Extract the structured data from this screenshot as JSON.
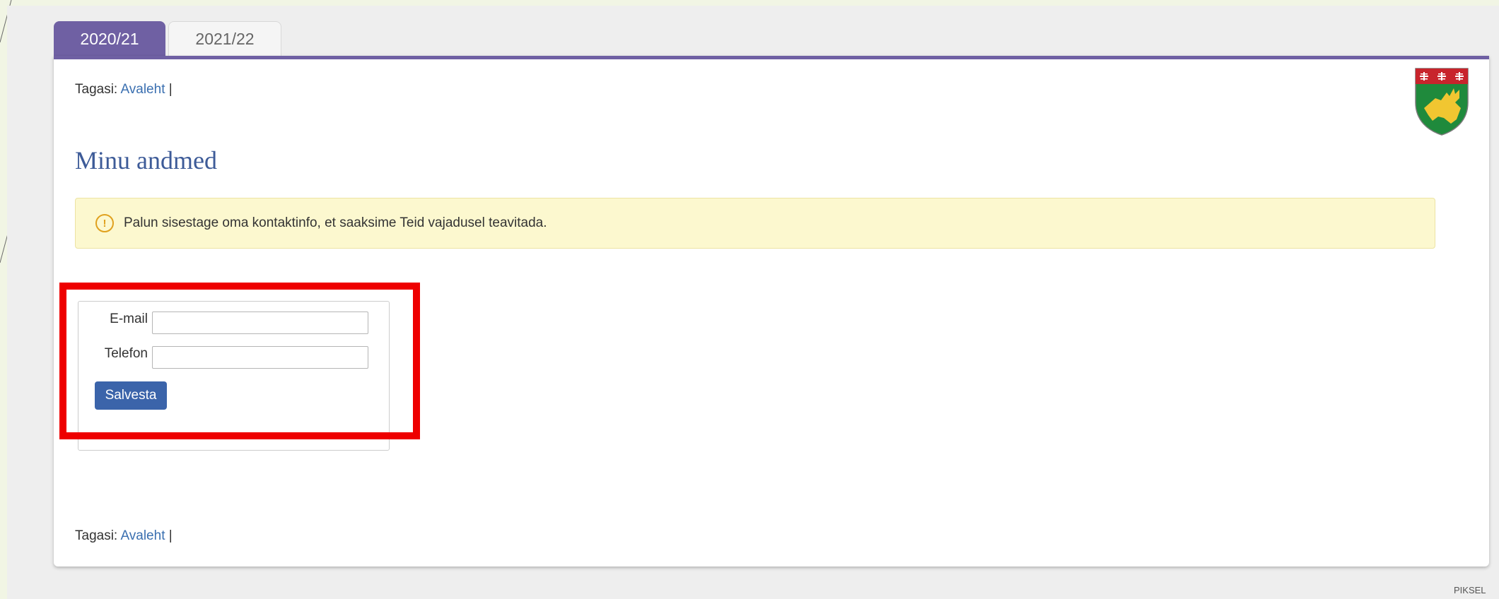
{
  "tabs": [
    {
      "label": "2020/21",
      "active": true
    },
    {
      "label": "2021/22",
      "active": false
    }
  ],
  "breadcrumb": {
    "prefix": "Tagasi:",
    "link": "Avaleht",
    "separator": "|"
  },
  "page": {
    "title": "Minu andmed"
  },
  "alert": {
    "icon": "exclamation-circle-icon",
    "message": "Palun sisestage oma kontaktinfo, et saaksime Teid vajadusel teavitada."
  },
  "form": {
    "email_label": "E-mail",
    "email_value": "",
    "phone_label": "Telefon",
    "phone_value": "",
    "save_label": "Salvesta"
  },
  "crest": {
    "icon": "coat-of-arms-icon"
  },
  "footer": {
    "brand": "PIKSEL"
  },
  "colors": {
    "accent": "#6f60a3",
    "link": "#3a6fb0",
    "title": "#3d5b98",
    "button": "#3b64aa",
    "alert_bg": "#fcf8cf",
    "highlight": "#ee0000"
  }
}
